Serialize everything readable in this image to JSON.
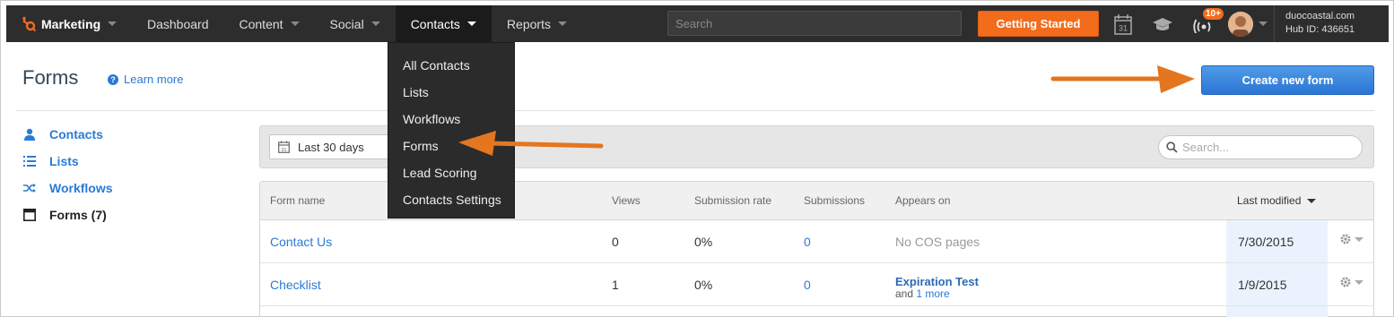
{
  "nav": {
    "brand": "Marketing",
    "items": [
      {
        "label": "Dashboard",
        "caret": false
      },
      {
        "label": "Content",
        "caret": true
      },
      {
        "label": "Social",
        "caret": true
      },
      {
        "label": "Contacts",
        "caret": true,
        "active": true
      },
      {
        "label": "Reports",
        "caret": true
      }
    ],
    "search_placeholder": "Search",
    "getting_started": "Getting Started",
    "calendar_day": "31",
    "notifications_badge": "10+",
    "account_name": "duocoastal.com",
    "hub_id": "Hub ID: 436651"
  },
  "dropdown": {
    "items": [
      "All Contacts",
      "Lists",
      "Workflows",
      "Forms",
      "Lead Scoring",
      "Contacts Settings"
    ]
  },
  "header": {
    "title": "Forms",
    "learn_more": "Learn more",
    "create_button": "Create new form"
  },
  "sidebar": {
    "items": [
      {
        "label": "Contacts",
        "icon": "person-icon"
      },
      {
        "label": "Lists",
        "icon": "list-icon"
      },
      {
        "label": "Workflows",
        "icon": "shuffle-icon"
      },
      {
        "label": "Forms (7)",
        "icon": "form-icon",
        "current": true
      }
    ]
  },
  "filters": {
    "date_range": "Last 30 days",
    "search_placeholder": "Search..."
  },
  "table": {
    "columns": [
      "Form name",
      "Views",
      "Submission rate",
      "Submissions",
      "Appears on",
      "Last modified"
    ],
    "rows": [
      {
        "name": "Contact Us",
        "views": "0",
        "rate": "0%",
        "submissions": "0",
        "appears_on": "No COS pages",
        "appears_more": "",
        "modified": "7/30/2015"
      },
      {
        "name": "Checklist",
        "views": "1",
        "rate": "0%",
        "submissions": "0",
        "appears_on": "Expiration Test",
        "appears_more_prefix": "and",
        "appears_more": "1 more",
        "modified": "1/9/2015"
      }
    ]
  },
  "colors": {
    "nav_bg": "#2d2d2d",
    "accent_orange": "#f26c1c",
    "link_blue": "#2a7ad6",
    "primary_button": "#2b75d3"
  }
}
